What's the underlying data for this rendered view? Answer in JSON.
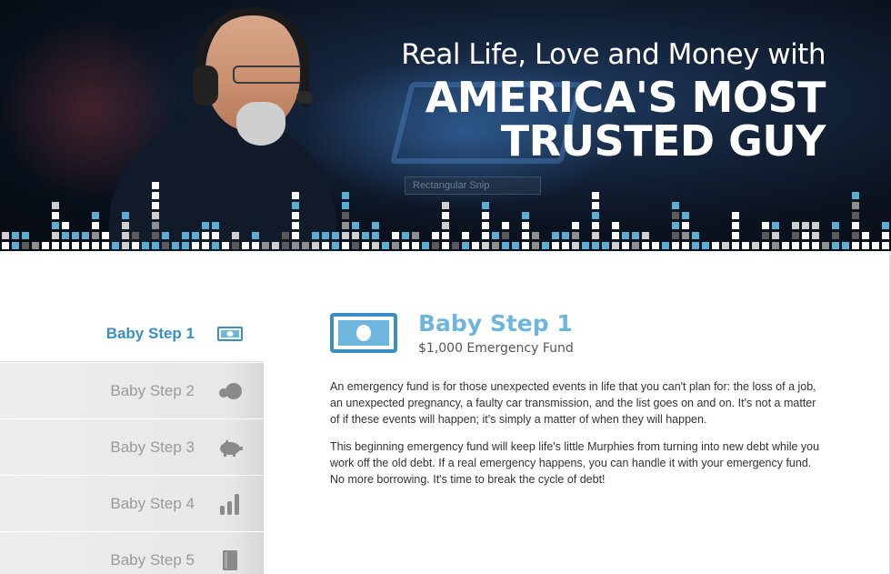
{
  "hero": {
    "tagline": "Real Life, Love and Money with",
    "headline": "AMERICA'S MOST TRUSTED GUY",
    "photo_caption": "Rectangular Snip"
  },
  "sidebar": {
    "items": [
      {
        "label": "Baby Step 1",
        "icon": "money-bill-icon",
        "active": true
      },
      {
        "label": "Baby Step 2",
        "icon": "snowball-icon",
        "active": false
      },
      {
        "label": "Baby Step 3",
        "icon": "piggy-bank-icon",
        "active": false
      },
      {
        "label": "Baby Step 4",
        "icon": "bar-chart-icon",
        "active": false
      },
      {
        "label": "Baby Step 5",
        "icon": "book-icon",
        "active": false
      }
    ]
  },
  "main": {
    "title": "Baby Step 1",
    "subtitle": "$1,000 Emergency Fund",
    "icon": "money-bill-icon",
    "paragraphs": [
      "An emergency fund is for those unexpected events in life that you can't plan for: the loss of a job, an unexpected pregnancy, a faulty car transmission, and the list goes on and on. It's not a matter of if these events will happen; it's simply a matter of when they will happen.",
      "This beginning emergency fund will keep life's little Murphies from turning into new debt while you work off the old debt. If a real emergency happens, you can handle it with your emergency fund. No more borrowing. It's time to break the cycle of debt!"
    ]
  },
  "colors": {
    "accent_blue": "#6fb6de",
    "active_blue": "#3a8fc4",
    "inactive_gray": "#9a9a9a",
    "eq_blue": "#5aaed3"
  }
}
